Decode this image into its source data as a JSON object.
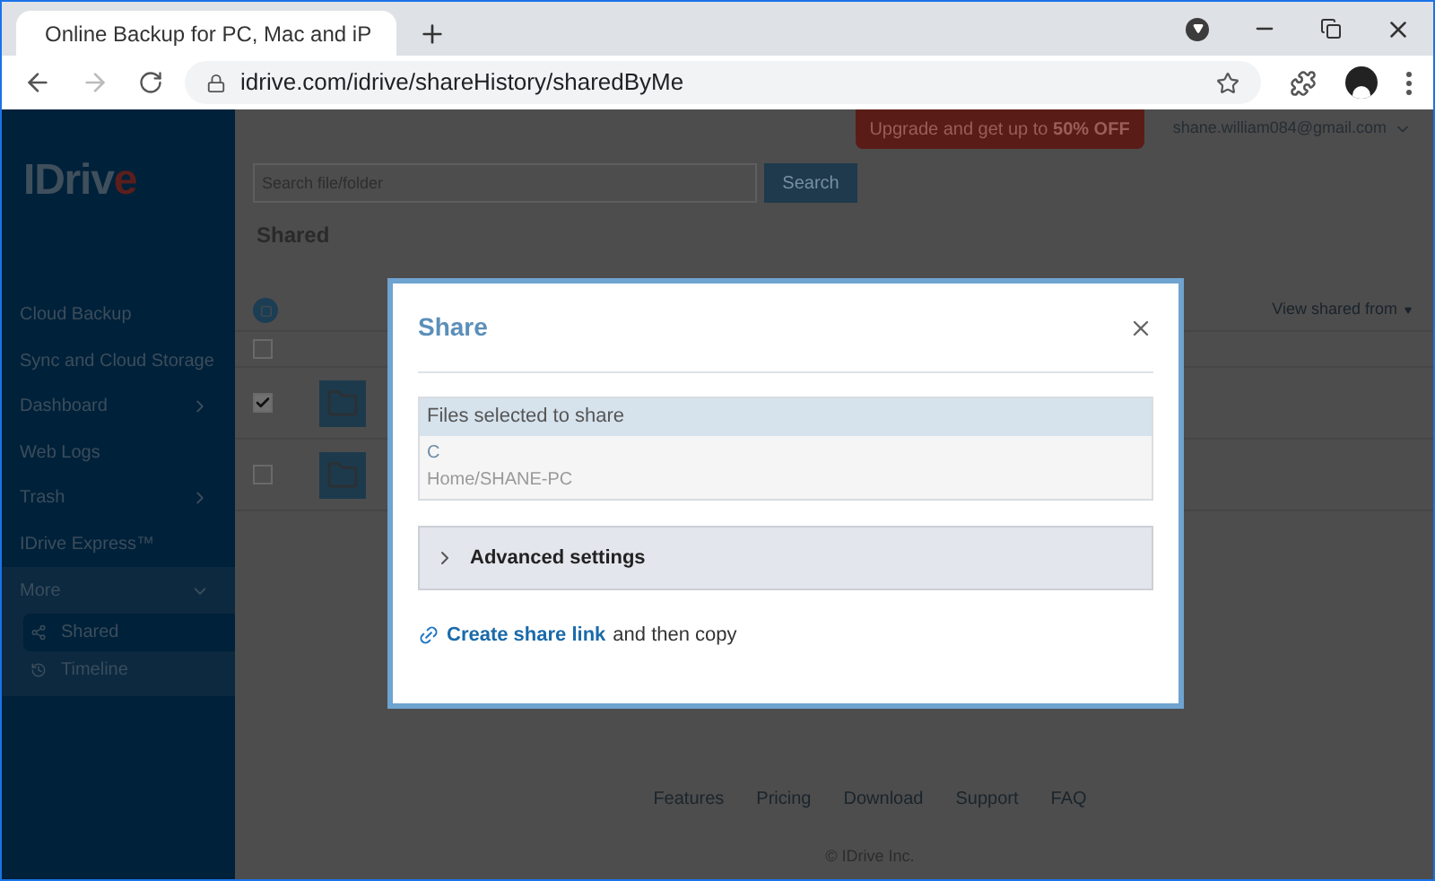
{
  "browser": {
    "tab_title": "Online Backup for PC, Mac and iP",
    "url": "idrive.com/idrive/shareHistory/sharedByMe"
  },
  "header": {
    "upgrade": "Upgrade and get up to **50% OFF**",
    "account": "shane.william084@gmail.com"
  },
  "search": {
    "placeholder": "Search file/folder",
    "button": "Search"
  },
  "page_title": "Shared",
  "sidebar": {
    "logo": "IDriv",
    "logo_letter": "e",
    "items": [
      {
        "label": "Cloud Backup",
        "kind": "plain"
      },
      {
        "label": "Sync and Cloud Storage",
        "kind": "plain"
      },
      {
        "label": "Dashboard",
        "kind": "submenu"
      },
      {
        "label": "Web Logs",
        "kind": "plain"
      },
      {
        "label": "Trash",
        "kind": "submenu"
      },
      {
        "label": "IDrive Express™",
        "kind": "plain"
      },
      {
        "label": "More",
        "kind": "group",
        "expanded": true,
        "children": [
          {
            "label": "Shared",
            "kind": "share",
            "selected": true
          },
          {
            "label": "Timeline",
            "kind": "history",
            "selected": false
          }
        ]
      }
    ]
  },
  "table": {
    "filter": "View shared from",
    "rows": [
      {
        "checked": false,
        "kind": "empty"
      },
      {
        "checked": true,
        "kind": "folder"
      },
      {
        "checked": false,
        "kind": "folder"
      }
    ]
  },
  "footer": {
    "links": [
      "Features",
      "Pricing",
      "Download",
      "Support",
      "FAQ"
    ],
    "copyright": "© IDrive Inc."
  },
  "dialog": {
    "title": "Share",
    "files_heading": "Files selected to share",
    "files": [
      {
        "name": "C",
        "path": "Home/SHANE-PC"
      }
    ],
    "advanced": {
      "label": "Advanced settings",
      "expanded": false
    },
    "link_label": "Create share link",
    "link_suffix": "and then copy"
  }
}
